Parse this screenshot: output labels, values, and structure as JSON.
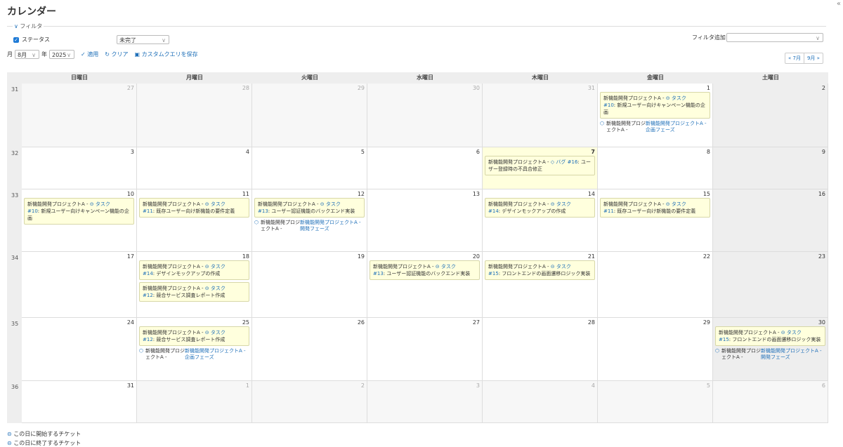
{
  "page": {
    "title": "カレンダー"
  },
  "filter": {
    "legend": "フィルタ",
    "status_label": "ステータス",
    "status_value": "未完了",
    "add_filter_label": "フィルタ追加",
    "add_filter_value": "",
    "month_label": "月",
    "month_value": "8月",
    "year_label": "年",
    "year_value": "2025",
    "apply": "適用",
    "clear": "クリア",
    "save_query": "カスタムクエリを保存"
  },
  "nav": {
    "prev": "« 7月",
    "next": "9月 »"
  },
  "calendar": {
    "weekdays": [
      "日曜日",
      "月曜日",
      "火曜日",
      "水曜日",
      "木曜日",
      "金曜日",
      "土曜日"
    ],
    "weeks": [
      {
        "no": "31",
        "days": [
          "27",
          "28",
          "29",
          "30",
          "31",
          "1",
          "2"
        ]
      },
      {
        "no": "32",
        "days": [
          "3",
          "4",
          "5",
          "6",
          "7",
          "8",
          "9"
        ]
      },
      {
        "no": "33",
        "days": [
          "10",
          "11",
          "12",
          "13",
          "14",
          "15",
          "16"
        ]
      },
      {
        "no": "34",
        "days": [
          "17",
          "18",
          "19",
          "20",
          "21",
          "22",
          "23"
        ]
      },
      {
        "no": "35",
        "days": [
          "24",
          "25",
          "26",
          "27",
          "28",
          "29",
          "30"
        ]
      },
      {
        "no": "36",
        "days": [
          "31",
          "1",
          "2",
          "3",
          "4",
          "5",
          "6"
        ]
      }
    ],
    "issues": [
      {
        "w": 0,
        "d": 5,
        "slot": 0,
        "project": "新機能開発プロジェクトA -",
        "tracker": "タスク",
        "id": "#10",
        "subject": ": 新規ユーザー向けキャンペーン機能の企画",
        "icon": "start"
      },
      {
        "w": 1,
        "d": 4,
        "slot": 0,
        "project": "新機能開発プロジェクトA -",
        "tracker": "バグ",
        "id": "#16",
        "subject": ": ユーザー登録時の不具合修正",
        "icon": "diamond"
      },
      {
        "w": 2,
        "d": 0,
        "slot": 0,
        "project": "新機能開発プロジェクトA -",
        "tracker": "タスク",
        "id": "#10",
        "subject": ": 新規ユーザー向けキャンペーン機能の企画",
        "icon": "end"
      },
      {
        "w": 2,
        "d": 1,
        "slot": 0,
        "project": "新機能開発プロジェクトA -",
        "tracker": "タスク",
        "id": "#11",
        "subject": ": 既存ユーザー向け新機能の要件定義",
        "icon": "start"
      },
      {
        "w": 2,
        "d": 2,
        "slot": 0,
        "project": "新機能開発プロジェクトA -",
        "tracker": "タスク",
        "id": "#13",
        "subject": ": ユーザー認証機能のバックエンド実装",
        "icon": "start"
      },
      {
        "w": 2,
        "d": 4,
        "slot": 0,
        "project": "新機能開発プロジェクトA -",
        "tracker": "タスク",
        "id": "#14",
        "subject": ": デザインモックアップの作成",
        "icon": "start"
      },
      {
        "w": 2,
        "d": 5,
        "slot": 0,
        "project": "新機能開発プロジェクトA -",
        "tracker": "タスク",
        "id": "#11",
        "subject": ": 既存ユーザー向け新機能の要件定義",
        "icon": "end"
      },
      {
        "w": 3,
        "d": 1,
        "slot": 0,
        "project": "新機能開発プロジェクトA -",
        "tracker": "タスク",
        "id": "#14",
        "subject": ": デザインモックアップの作成",
        "icon": "end"
      },
      {
        "w": 3,
        "d": 1,
        "slot": 1,
        "project": "新機能開発プロジェクトA -",
        "tracker": "タスク",
        "id": "#12",
        "subject": ": 競合サービス調査レポート作成",
        "icon": "start"
      },
      {
        "w": 3,
        "d": 3,
        "slot": 0,
        "project": "新機能開発プロジェクトA -",
        "tracker": "タスク",
        "id": "#13",
        "subject": ": ユーザー認証機能のバックエンド実装",
        "icon": "end"
      },
      {
        "w": 3,
        "d": 4,
        "slot": 0,
        "project": "新機能開発プロジェクトA -",
        "tracker": "タスク",
        "id": "#15",
        "subject": ": フロントエンドの画面遷移ロジック実装",
        "icon": "start"
      },
      {
        "w": 4,
        "d": 1,
        "slot": 0,
        "project": "新機能開発プロジェクトA -",
        "tracker": "タスク",
        "id": "#12",
        "subject": ": 競合サービス調査レポート作成",
        "icon": "end"
      },
      {
        "w": 4,
        "d": 6,
        "slot": 0,
        "project": "新機能開発プロジェクトA -",
        "tracker": "タスク",
        "id": "#15",
        "subject": ": フロントエンドの画面遷移ロジック実装",
        "icon": "end"
      }
    ],
    "versions": [
      {
        "w": 0,
        "d": 5,
        "project": "新機能開発プロジェクトA -",
        "name": "新機能開発プロジェクトA - 企画フェーズ"
      },
      {
        "w": 2,
        "d": 2,
        "project": "新機能開発プロジェクトA -",
        "name": "新機能開発プロジェクトA - 開発フェーズ"
      },
      {
        "w": 4,
        "d": 1,
        "project": "新機能開発プロジェクトA -",
        "name": "新機能開発プロジェクトA - 企画フェーズ"
      },
      {
        "w": 4,
        "d": 6,
        "project": "新機能開発プロジェクトA -",
        "name": "新機能開発プロジェクトA - 開発フェーズ"
      }
    ]
  },
  "legend": {
    "starts": "この日に開始するチケット",
    "ends": "この日に終了するチケット"
  }
}
